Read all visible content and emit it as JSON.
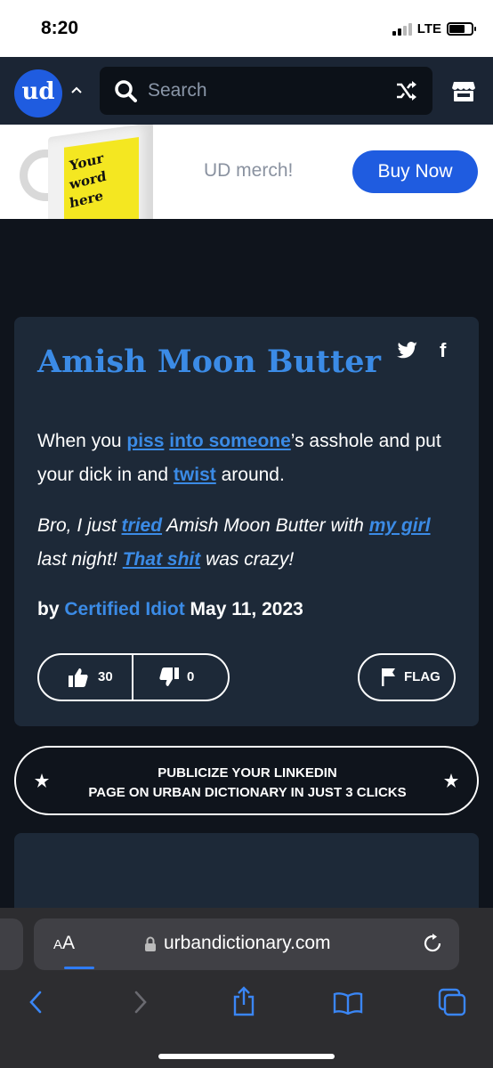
{
  "status_bar": {
    "time": "8:20",
    "network": "LTE",
    "battery_level": 0.7
  },
  "header": {
    "logo_text": "ud",
    "search_placeholder": "Search"
  },
  "merch": {
    "mug_lines": [
      "Your",
      "word",
      "here"
    ],
    "label": "UD merch!",
    "button": "Buy Now"
  },
  "definition": {
    "word": "Amish Moon Butter",
    "meaning": [
      {
        "text": "When you ",
        "link": false
      },
      {
        "text": "piss",
        "link": true
      },
      {
        "text": " ",
        "link": false
      },
      {
        "text": "into someone",
        "link": true
      },
      {
        "text": "’s asshole and put your dick in and ",
        "link": false
      },
      {
        "text": "twist",
        "link": true
      },
      {
        "text": " around.",
        "link": false
      }
    ],
    "example": [
      {
        "text": "Bro, I just ",
        "link": false
      },
      {
        "text": "tried",
        "link": true
      },
      {
        "text": " Amish Moon Butter with ",
        "link": false
      },
      {
        "text": "my girl",
        "link": true
      },
      {
        "text": " last night! ",
        "link": false
      },
      {
        "text": "That shit",
        "link": true
      },
      {
        "text": " was crazy!",
        "link": false
      }
    ],
    "by": "by",
    "author": "Certified Idiot",
    "date": "May 11, 2023",
    "upvotes": "30",
    "downvotes": "0",
    "flag_label": "FLAG"
  },
  "promo": {
    "line1": "PUBLICIZE YOUR LINKEDIN",
    "line2": "PAGE ON URBAN DICTIONARY IN JUST 3 CLICKS"
  },
  "browser": {
    "aa_label_small": "A",
    "aa_label_large": "A",
    "url": "urbandictionary.com"
  }
}
